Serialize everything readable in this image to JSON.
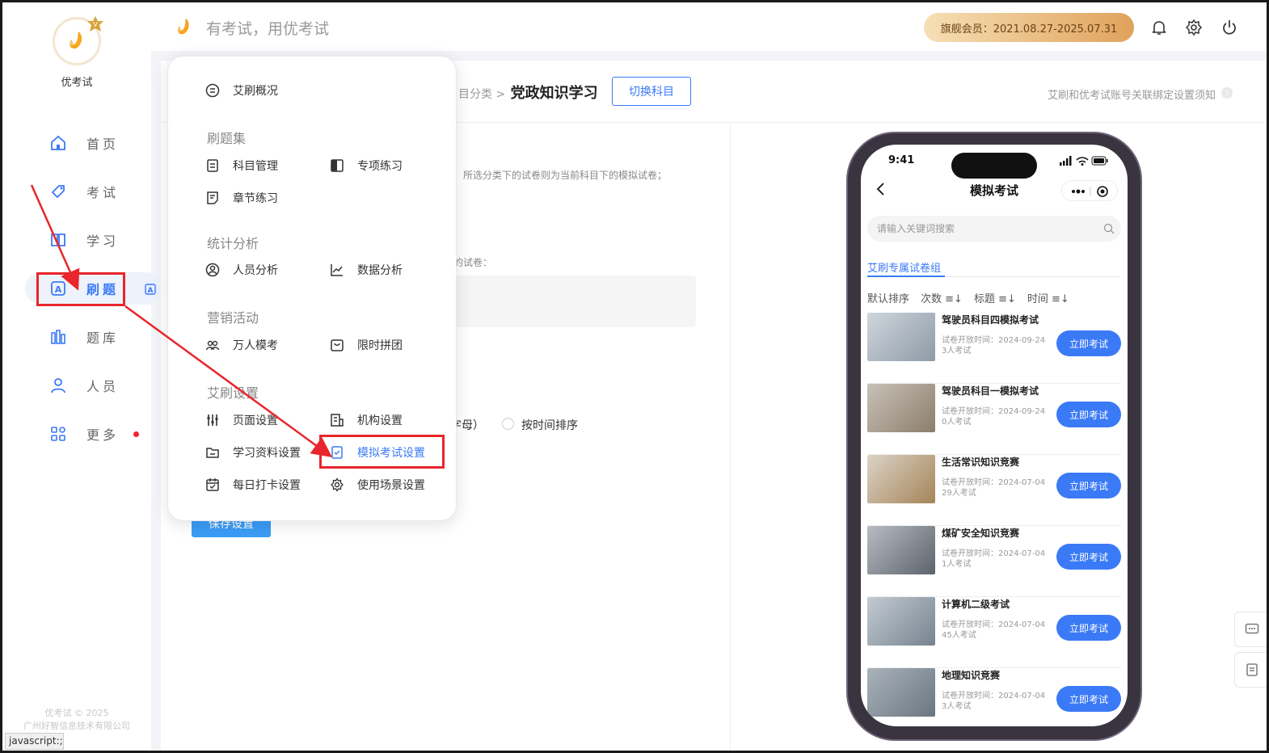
{
  "app": {
    "logo_text": "优考试",
    "copyright": [
      "优考试 © 2025",
      "广州好智信息技术有限公司"
    ],
    "statusbar": "javascript:;"
  },
  "nav": [
    {
      "label": "首页",
      "icon": "home-icon"
    },
    {
      "label": "考试",
      "icon": "tag-icon"
    },
    {
      "label": "学习",
      "icon": "book-icon"
    },
    {
      "label": "刷题",
      "icon": "practice-icon",
      "active": true
    },
    {
      "label": "题库",
      "icon": "bank-icon"
    },
    {
      "label": "人员",
      "icon": "user-icon"
    },
    {
      "label": "更多",
      "icon": "apps-icon",
      "dot": true
    }
  ],
  "topbar": {
    "slogan": "有考试，用优考试",
    "vip": "旗舰会员：2021.08.27-2025.07.31"
  },
  "page": {
    "breadcrumb_prefix": "目分类 >",
    "breadcrumb_current": "党政知识学习",
    "switch_subject": "切换科目",
    "bind_note": "艾刷和优考试账号关联绑定设置须知",
    "desc_category": "所选分类下的试卷则为当前科目下的模拟试卷；",
    "desc_paper": "的试卷：",
    "sort_option_partial": "字母）",
    "sort_option_time": "按时间排序",
    "save": "保存设置"
  },
  "menu": {
    "overview": "艾刷概况",
    "groups": [
      {
        "title": "刷题集",
        "items": [
          "科目管理",
          "专项练习",
          "章节练习"
        ]
      },
      {
        "title": "统计分析",
        "items": [
          "人员分析",
          "数据分析"
        ]
      },
      {
        "title": "营销活动",
        "items": [
          "万人模考",
          "限时拼团"
        ]
      },
      {
        "title": "艾刷设置",
        "items": [
          "页面设置",
          "机构设置",
          "学习资料设置",
          "模拟考试设置",
          "每日打卡设置",
          "使用场景设置"
        ]
      }
    ],
    "highlighted": "模拟考试设置"
  },
  "phone": {
    "time": "9:41",
    "title": "模拟考试",
    "search_placeholder": "请输入关键词搜索",
    "tab": "艾刷专属试卷组",
    "sorts": [
      "默认排序",
      "次数 ≡↓",
      "标题 ≡↓",
      "时间 ≡↓"
    ],
    "meta_label": "试卷开放时间：",
    "button": "立即考试",
    "cards": [
      {
        "name": "驾驶员科目四模拟考试",
        "date": "2024-09-24",
        "count": "3人考试"
      },
      {
        "name": "驾驶员科目一模拟考试",
        "date": "2024-09-24",
        "count": "0人考试"
      },
      {
        "name": "生活常识知识竞赛",
        "date": "2024-07-04",
        "count": "29人考试"
      },
      {
        "name": "煤矿安全知识竞赛",
        "date": "2024-07-04",
        "count": "1人考试"
      },
      {
        "name": "计算机二级考试",
        "date": "2024-07-04",
        "count": "45人考试"
      },
      {
        "name": "地理知识竞赛",
        "date": "2024-07-04",
        "count": "3人考试"
      }
    ]
  },
  "colors": {
    "accent": "#3b7af6",
    "annotation": "#e8262b",
    "vip_start": "#f6dfb6",
    "vip_end": "#e0a25c",
    "logo": "#f5a623"
  }
}
